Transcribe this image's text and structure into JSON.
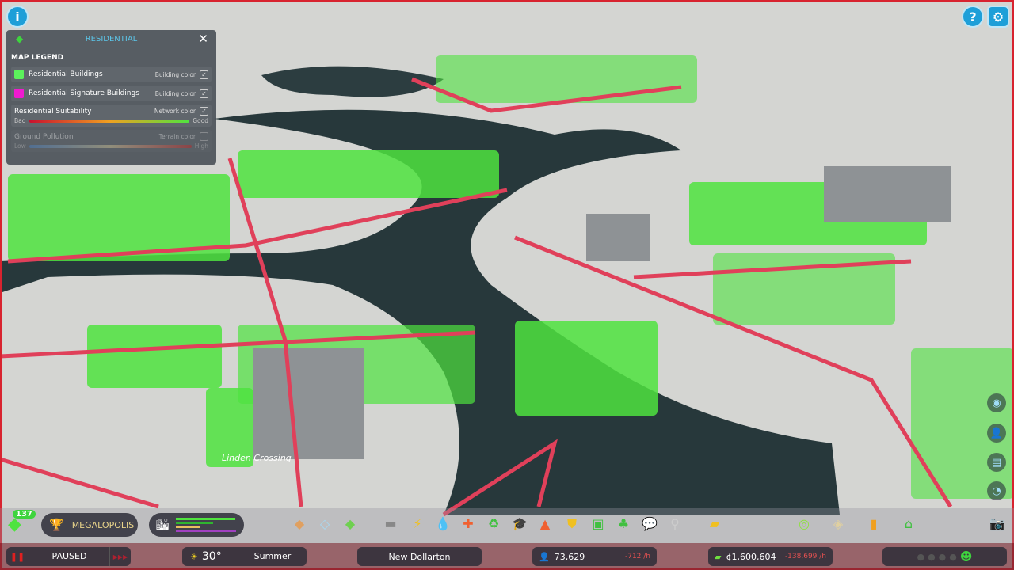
{
  "legend": {
    "title": "RESIDENTIAL",
    "heading": "MAP LEGEND",
    "items": [
      {
        "label": "Residential Buildings",
        "mode": "Building color",
        "color": "#5cf25c",
        "checked": true
      },
      {
        "label": "Residential Signature Buildings",
        "mode": "Building color",
        "color": "#f01bd0",
        "checked": true
      }
    ],
    "suitability": {
      "label": "Residential Suitability",
      "mode": "Network color",
      "low": "Bad",
      "high": "Good",
      "checked": true
    },
    "pollution": {
      "label": "Ground Pollution",
      "mode": "Terrain color",
      "low": "Low",
      "high": "High",
      "checked": false
    }
  },
  "map": {
    "district_label": "Linden Crossing"
  },
  "toolbar": {
    "level": "137",
    "milestone": "MEGALOPOLIS",
    "tools": [
      "zoning-icon",
      "area-icon",
      "landscaping-icon",
      "roads-icon",
      "electricity-icon",
      "water-icon",
      "health-icon",
      "garbage-icon",
      "education-icon",
      "fire-icon",
      "police-icon",
      "transport-icon",
      "parks-icon",
      "communications-icon",
      "shovel-icon",
      "bulldozer-icon"
    ],
    "right_tools": [
      "infoviews-icon",
      "map-icon",
      "statistics-icon",
      "progression-icon"
    ]
  },
  "status": {
    "sim": "PAUSED",
    "temperature": "30°",
    "season": "Summer",
    "city": "New Dollarton",
    "population": "73,629",
    "population_rate": "-712 /h",
    "money": "¢1,600,604",
    "money_rate": "-138,699 /h",
    "happiness": "happy"
  },
  "colors": {
    "accent": "#1e9fd8",
    "residential": "#5cf25c",
    "road": "#e0405a",
    "water": "#27383b"
  }
}
